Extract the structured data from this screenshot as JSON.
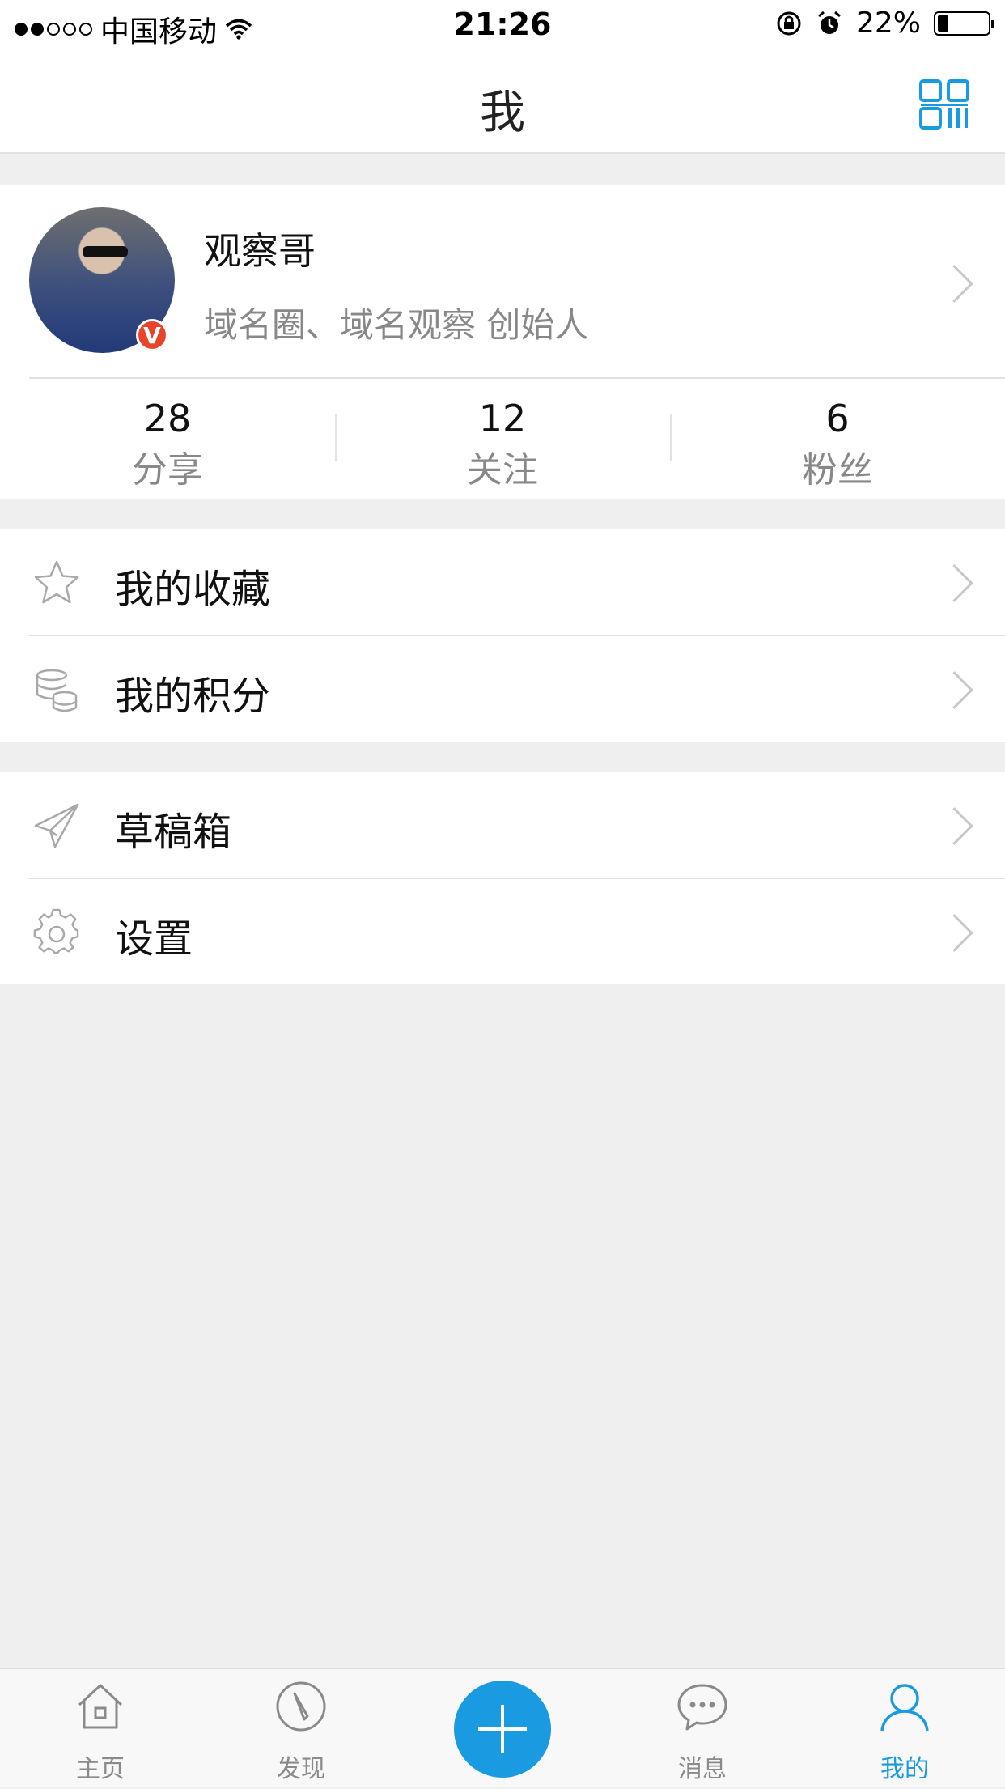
{
  "status_bar": {
    "signal_dots_filled": 2,
    "signal_dots_total": 5,
    "carrier": "中国移动",
    "time": "21:26",
    "battery_text": "22%",
    "battery_level": 0.22
  },
  "nav": {
    "title": "我",
    "right_icon": "qr-code-icon"
  },
  "profile": {
    "name": "观察哥",
    "bio": "域名圈、域名观察 创始人",
    "verified_badge": "V",
    "stats": [
      {
        "value": "28",
        "label": "分享"
      },
      {
        "value": "12",
        "label": "关注"
      },
      {
        "value": "6",
        "label": "粉丝"
      }
    ]
  },
  "menu_group1": [
    {
      "label": "我的收藏",
      "icon": "star-icon"
    },
    {
      "label": "我的积分",
      "icon": "database-icon"
    }
  ],
  "menu_group2": [
    {
      "label": "草稿箱",
      "icon": "paper-plane-icon"
    },
    {
      "label": "设置",
      "icon": "gear-icon"
    }
  ],
  "tabbar": {
    "tabs": [
      {
        "label": "主页",
        "icon": "home-icon"
      },
      {
        "label": "发现",
        "icon": "compass-icon"
      },
      {
        "label": "",
        "icon": "plus-icon"
      },
      {
        "label": "消息",
        "icon": "chat-bubble-icon"
      },
      {
        "label": "我的",
        "icon": "person-icon",
        "active": true
      }
    ]
  },
  "colors": {
    "accent": "#1a9ae0",
    "badge": "#e8442c",
    "background": "#efefef",
    "muted_text": "#888888"
  }
}
